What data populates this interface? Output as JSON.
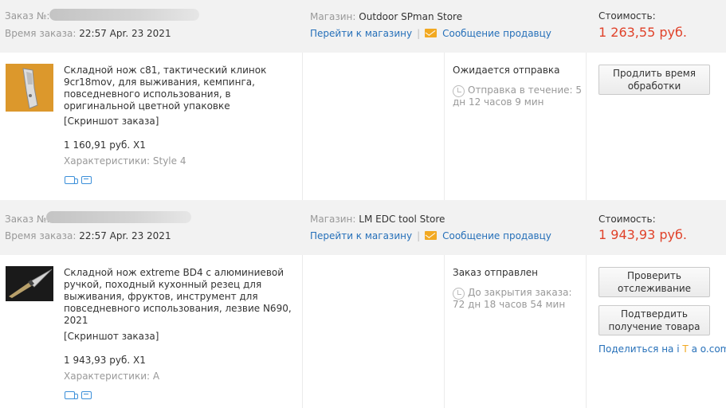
{
  "orders": [
    {
      "order_no_label": "Заказ №:",
      "order_time_label": "Время заказа:",
      "order_time": "22:57 Apr. 23 2021",
      "store_label": "Магазин:",
      "store_name": "Outdoor SPman Store",
      "go_to_store": "Перейти к магазину",
      "separator": "|",
      "message_seller": "Сообщение продавцу",
      "cost_label": "Стоимость:",
      "cost": "1 263,55 руб.",
      "product_title": "Складной нож c81, тактический клинок 9cr18mov, для выживания, кемпинга, повседневного использования, в оригинальной цветной упаковке",
      "screenshot_link": "[Скриншот заказа]",
      "unit_price": "1 160,91 руб. X1",
      "characteristics": "Характеристики: Style 4",
      "status": "Ожидается отправка",
      "timer_text": "Отправка в течение: 5 дн 12 часов 9 мин",
      "buttons": [
        "Продлить время обработки"
      ]
    },
    {
      "order_no_label": "Заказ №:",
      "order_time_label": "Время заказа:",
      "order_time": "22:57 Apr. 23 2021",
      "store_label": "Магазин:",
      "store_name": "LM EDC tool Store",
      "go_to_store": "Перейти к магазину",
      "separator": "|",
      "message_seller": "Сообщение продавцу",
      "cost_label": "Стоимость:",
      "cost": "1 943,93 руб.",
      "product_title": "Складной нож extreme BD4 с алюминиевой ручкой, походный кухонный резец для выживания, фруктов, инструмент для повседневного использования, лезвие N690, 2021",
      "screenshot_link": "[Скриншот заказа]",
      "unit_price": "1 943,93 руб. X1",
      "characteristics": "Характеристики: A",
      "status": "Заказ отправлен",
      "timer_text": "До закрытия заказа: 72 дн 18 часов 54 мин",
      "buttons": [
        "Проверить отслеживание",
        "Подтвердить получение товара"
      ],
      "share_prefix": "Поделиться на",
      "share_brand": [
        "i",
        "T",
        "a",
        "o"
      ],
      "share_suffix": ".com"
    }
  ],
  "colors": {
    "accent_red": "#e0422a",
    "link_blue": "#2670b9",
    "header_bg": "#f2f2f2",
    "mail_orange": "#f2a922"
  },
  "icons": [
    "mail-icon",
    "clock-icon",
    "shipping-icon",
    "return-icon"
  ]
}
